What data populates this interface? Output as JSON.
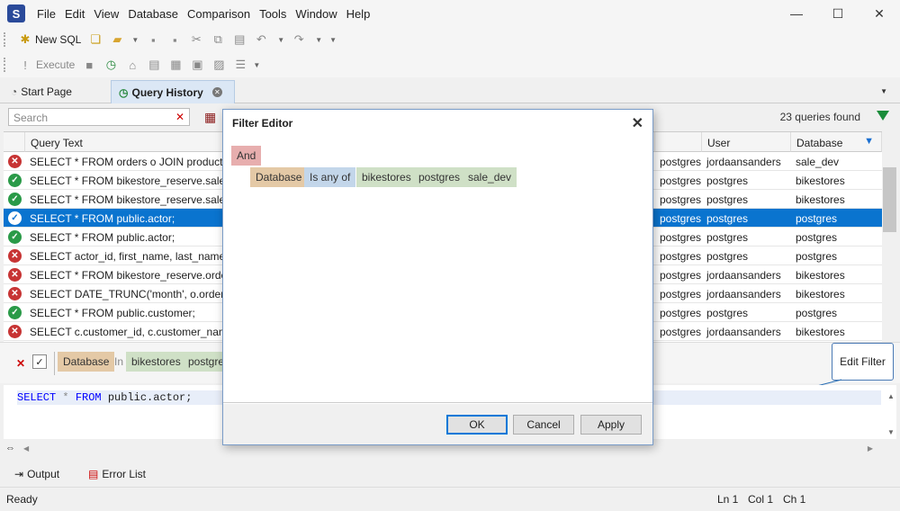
{
  "menu": {
    "items": [
      "File",
      "Edit",
      "View",
      "Database",
      "Comparison",
      "Tools",
      "Window",
      "Help"
    ]
  },
  "window": {
    "minimize": "—",
    "maximize": "☐",
    "close": "✕"
  },
  "toolbar1": {
    "new_sql": "New SQL"
  },
  "toolbar2": {
    "execute": "Execute"
  },
  "tabs": {
    "start_page": "Start Page",
    "query_history": "Query History"
  },
  "search": {
    "placeholder": "Search"
  },
  "summary": {
    "count_text": "23 queries found"
  },
  "grid": {
    "headers": {
      "query_text": "Query Text",
      "user": "User",
      "database": "Database"
    },
    "rows": [
      {
        "status": "error",
        "query": "SELECT * FROM orders o JOIN products p O",
        "login": "postgres",
        "user": "jordaansanders",
        "database": "sale_dev"
      },
      {
        "status": "ok",
        "query": "SELECT * FROM bikestore_reserve.sales_by",
        "login": "postgres",
        "user": "postgres",
        "database": "bikestores"
      },
      {
        "status": "ok",
        "query": "SELECT * FROM bikestore_reserve.sales_by",
        "login": "postgres",
        "user": "postgres",
        "database": "bikestores"
      },
      {
        "status": "ok",
        "query": "SELECT * FROM public.actor;",
        "login": "postgres",
        "user": "postgres",
        "database": "postgres"
      },
      {
        "status": "ok",
        "query": "SELECT * FROM public.actor;",
        "login": "postgres",
        "user": "postgres",
        "database": "postgres"
      },
      {
        "status": "error",
        "query": "SELECT actor_id, first_name, last_name FRO",
        "login": "postgres",
        "user": "postgres",
        "database": "postgres"
      },
      {
        "status": "error",
        "query": "SELECT * FROM bikestore_reserve.orders o",
        "login": "postgres",
        "user": "jordaansanders",
        "database": "bikestores"
      },
      {
        "status": "error",
        "query": "SELECT DATE_TRUNC('month', o.order_date",
        "login": "postgres",
        "user": "jordaansanders",
        "database": "bikestores"
      },
      {
        "status": "ok",
        "query": "SELECT * FROM public.customer;",
        "login": "postgres",
        "user": "postgres",
        "database": "postgres"
      },
      {
        "status": "error",
        "query": "SELECT c.customer_id, c.customer_name, SU",
        "login": "postgres",
        "user": "jordaansanders",
        "database": "bikestores"
      }
    ]
  },
  "filter_bar": {
    "field": "Database",
    "op": "In",
    "values": [
      "bikestores",
      "postgres"
    ]
  },
  "edit_filter": "Edit Filter",
  "editor": {
    "kw1": "SELECT",
    "star": "*",
    "kw2": "FROM",
    "rest": "public.actor;"
  },
  "bottom": {
    "output": "Output",
    "error_list": "Error List"
  },
  "status": {
    "ready": "Ready",
    "ln": "Ln 1",
    "col": "Col 1",
    "ch": "Ch 1"
  },
  "dialog": {
    "title": "Filter Editor",
    "logic": "And",
    "field": "Database",
    "op": "Is any of",
    "values": [
      "bikestores",
      "postgres",
      "sale_dev"
    ],
    "ok": "OK",
    "cancel": "Cancel",
    "apply": "Apply"
  }
}
